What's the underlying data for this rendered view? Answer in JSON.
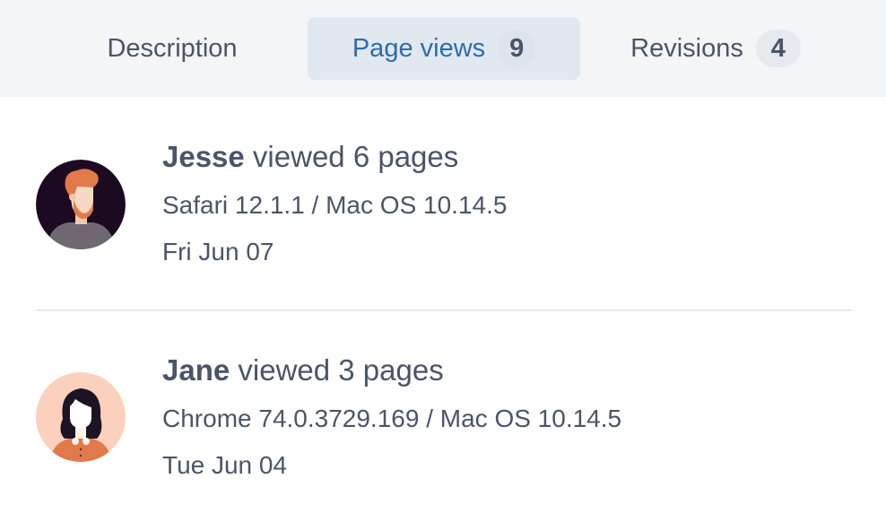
{
  "tabs": {
    "description": {
      "label": "Description"
    },
    "page_views": {
      "label": "Page views",
      "count": "9"
    },
    "revisions": {
      "label": "Revisions",
      "count": "4"
    }
  },
  "views": [
    {
      "user": "Jesse",
      "action": " viewed 6 pages",
      "browser": "Safari 12.1.1 / Mac OS 10.14.5",
      "date": "Fri Jun 07",
      "avatar_icon": "bearded-man-avatar"
    },
    {
      "user": "Jane",
      "action": " viewed 3 pages",
      "browser": "Chrome 74.0.3729.169 / Mac OS 10.14.5",
      "date": "Tue Jun 04",
      "avatar_icon": "woman-avatar"
    }
  ],
  "colors": {
    "active_tab_text": "#2b6cb0",
    "active_tab_bg": "#e2e8f0",
    "text": "#4a5568",
    "tabbar_bg": "#f4f5f7"
  }
}
